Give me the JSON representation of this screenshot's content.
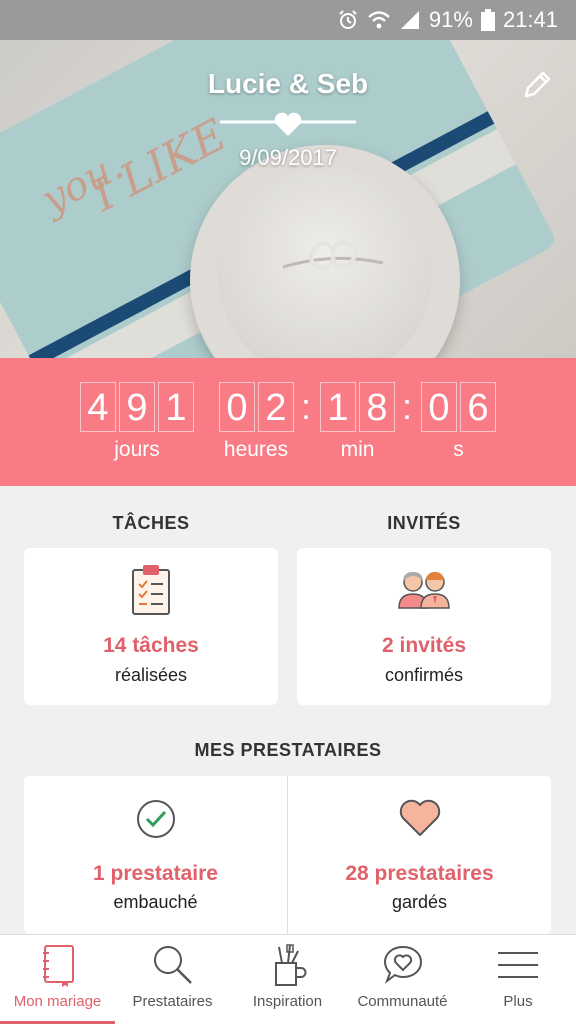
{
  "status_bar": {
    "battery": "91%",
    "time": "21:41"
  },
  "hero": {
    "names": "Lucie & Seb",
    "date": "9/09/2017",
    "script_text": [
      "I LIKE",
      "you."
    ]
  },
  "countdown": {
    "days": [
      "4",
      "9",
      "1"
    ],
    "hours": [
      "0",
      "2"
    ],
    "minutes": [
      "1",
      "8"
    ],
    "seconds": [
      "0",
      "6"
    ],
    "labels": {
      "days": "jours",
      "hours": "heures",
      "minutes": "min",
      "seconds": "s"
    }
  },
  "tasks": {
    "title": "TÂCHES",
    "count": "14 tâches",
    "subtitle": "réalisées"
  },
  "guests": {
    "title": "INVITÉS",
    "count": "2 invités",
    "subtitle": "confirmés"
  },
  "vendors": {
    "title": "MES PRESTATAIRES",
    "hired_count": "1 prestataire",
    "hired_label": "embauché",
    "saved_count": "28 prestataires",
    "saved_label": "gardés"
  },
  "nav": [
    {
      "label": "Mon mariage",
      "icon": "notebook-icon"
    },
    {
      "label": "Prestataires",
      "icon": "search-icon"
    },
    {
      "label": "Inspiration",
      "icon": "brushes-cup-icon"
    },
    {
      "label": "Communauté",
      "icon": "chat-heart-icon"
    },
    {
      "label": "Plus",
      "icon": "menu-icon"
    }
  ],
  "colors": {
    "accent": "#f97b86",
    "accent_text": "#e0616a",
    "check_green": "#2e9e5a",
    "heart_fill": "#f7b49c"
  }
}
